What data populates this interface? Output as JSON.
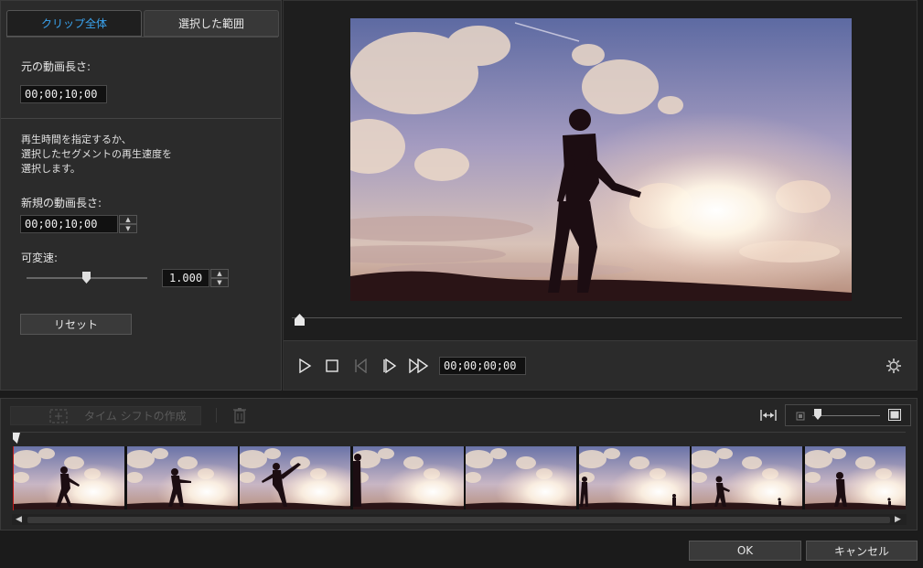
{
  "tabs": {
    "whole_clip": "クリップ全体",
    "selected_range": "選択した範囲"
  },
  "original_length": {
    "label": "元の動画長さ:",
    "value": "00;00;10;00"
  },
  "description": {
    "line1": "再生時間を指定するか、",
    "line2": "選択したセグメントの再生速度を",
    "line3": "選択します。"
  },
  "new_length": {
    "label": "新規の動画長さ:",
    "value": "00;00;10;00"
  },
  "variable_speed": {
    "label": "可変速:",
    "value": "1.000",
    "slider_level": 0.5
  },
  "reset_button": "リセット",
  "player": {
    "timecode": "00;00;00;00",
    "seek_position": 0
  },
  "timeline": {
    "create_timeshift": "タイム シフトの作成",
    "thumbnail_count": 8
  },
  "footer": {
    "ok": "OK",
    "cancel": "キャンセル"
  },
  "icons": {
    "play": "play-icon",
    "stop": "stop-icon",
    "prev_frame": "previous-frame-icon",
    "next_frame": "next-frame-icon",
    "fast_forward": "fast-forward-icon",
    "settings": "gear-icon",
    "trash": "trash-icon",
    "fit": "fit-to-window-icon"
  },
  "colors": {
    "accent": "#3aa4f0",
    "background": "#1b1b1b",
    "panel": "#2b2b2b"
  }
}
